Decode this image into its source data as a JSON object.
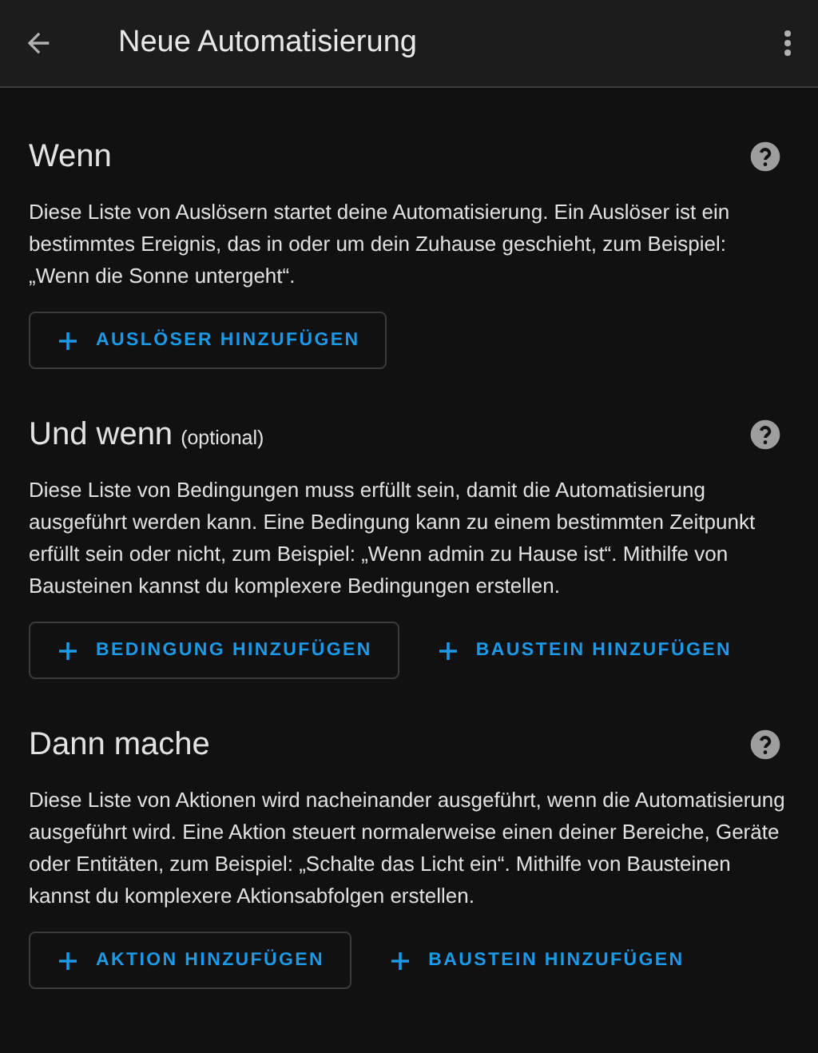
{
  "app_bar": {
    "title": "Neue Automatisierung"
  },
  "sections": [
    {
      "title": "Wenn",
      "description": "Diese Liste von Auslösern startet deine Automatisierung. Ein Auslöser ist ein bestimmtes Ereignis, das in oder um dein Zuhause geschieht, zum Beispiel: „Wenn die Sonne untergeht“.",
      "buttons": [
        {
          "label": "AUSLÖSER HINZUFÜGEN",
          "kind": "outlined"
        }
      ]
    },
    {
      "title": "Und wenn",
      "note": "(optional)",
      "description": "Diese Liste von Bedingungen muss erfüllt sein, damit die Automatisierung ausgeführt werden kann. Eine Bedingung kann zu einem bestimmten Zeitpunkt erfüllt sein oder nicht, zum Beispiel: „Wenn admin zu Hause ist“. Mithilfe von Bausteinen kannst du komplexere Bedingungen erstellen.",
      "buttons": [
        {
          "label": "BEDINGUNG HINZUFÜGEN",
          "kind": "outlined"
        },
        {
          "label": "BAUSTEIN HINZUFÜGEN",
          "kind": "text"
        }
      ]
    },
    {
      "title": "Dann mache",
      "description": "Diese Liste von Aktionen wird nacheinander ausgeführt, wenn die Automatisierung ausgeführt wird. Eine Aktion steuert normalerweise einen deiner Bereiche, Geräte oder Entitäten, zum Beispiel: „Schalte das Licht ein“. Mithilfe von Bausteinen kannst du komplexere Aktionsabfolgen erstellen.",
      "buttons": [
        {
          "label": "AKTION HINZUFÜGEN",
          "kind": "outlined"
        },
        {
          "label": "BAUSTEIN HINZUFÜGEN",
          "kind": "text"
        }
      ]
    }
  ]
}
